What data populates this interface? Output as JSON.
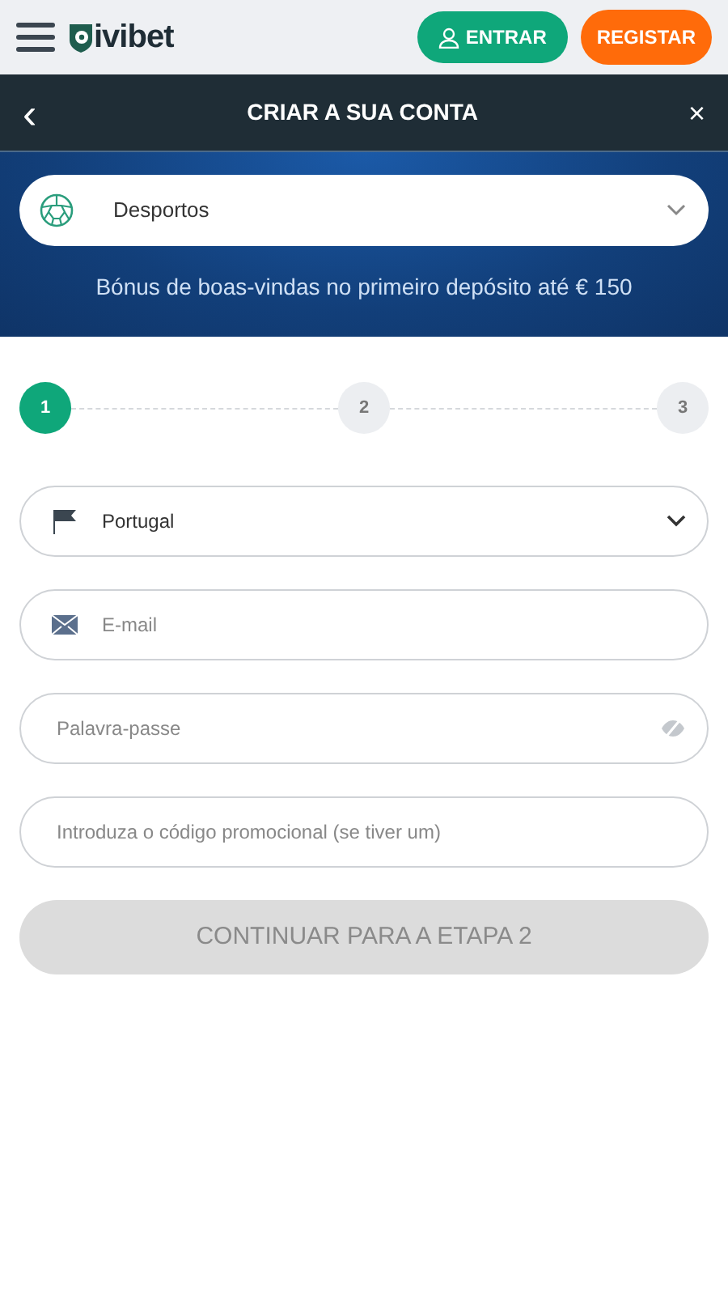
{
  "header": {
    "logo_text": "ivibet",
    "login_button": "ENTRAR",
    "register_button": "REGISTAR"
  },
  "title_bar": {
    "back": "‹",
    "title": "CRIAR A SUA CONTA",
    "close": "×"
  },
  "banner": {
    "product_select": {
      "value": "Desportos"
    },
    "bonus_text": "Bónus de boas-vindas no primeiro depósito até € 150"
  },
  "steps": [
    {
      "label": "1",
      "selected": true
    },
    {
      "label": "2",
      "selected": false
    },
    {
      "label": "3",
      "selected": false
    }
  ],
  "fields": [
    {
      "kind": "country",
      "value": "Portugal"
    },
    {
      "kind": "email",
      "placeholder": "E-mail"
    },
    {
      "kind": "password",
      "placeholder": "Palavra-passe"
    },
    {
      "kind": "promo",
      "placeholder": "Introduza o código promocional (se tiver um)"
    }
  ],
  "continue_button": {
    "label": "CONTINUAR PARA A ETAPA 2",
    "disabled": true
  }
}
